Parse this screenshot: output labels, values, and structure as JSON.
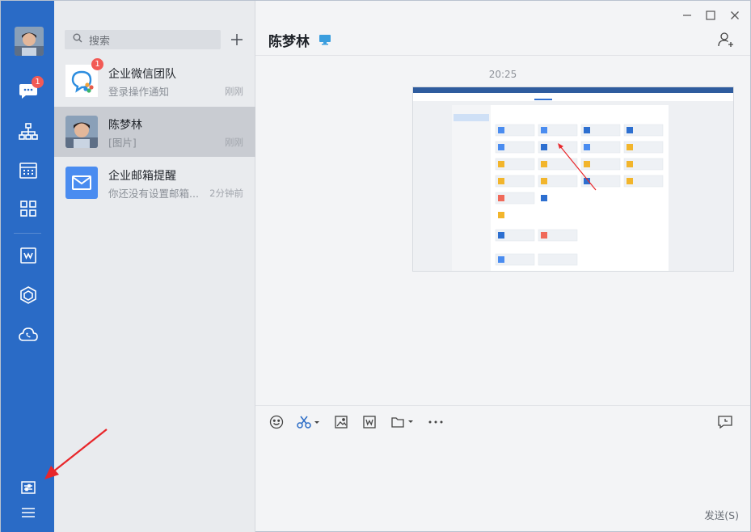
{
  "sidebar": {
    "chat_badge": "1"
  },
  "search": {
    "placeholder": "搜索"
  },
  "conversations": [
    {
      "name": "企业微信团队",
      "preview": "登录操作通知",
      "time": "刚刚",
      "badge": "1"
    },
    {
      "name": "陈梦林",
      "preview": "[图片]",
      "time": "刚刚"
    },
    {
      "name": "企业邮箱提醒",
      "preview": "你还没有设置邮箱...",
      "time": "2分钟前"
    }
  ],
  "chat": {
    "title": "陈梦林",
    "message_time": "20:25",
    "send_label": "发送(S)"
  },
  "colors": {
    "rail": "#2a6bc6",
    "badge": "#f25a55",
    "mail_icon": "#4a8cf0",
    "annotation_arrow": "#e8262a"
  }
}
